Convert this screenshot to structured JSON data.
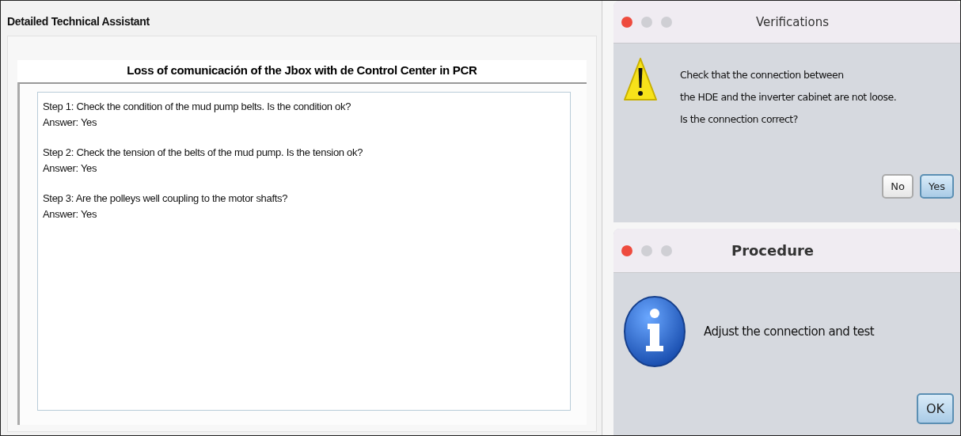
{
  "main_window": {
    "title": "Detailed Technical Assistant",
    "heading": "Loss of comunicación of the Jbox with de Control Center in PCR",
    "steps": [
      {
        "question": "Step 1: Check the condition of the mud pump belts. Is the condition ok?",
        "answer": "Answer: Yes"
      },
      {
        "question": "Step 2: Check the tension of the belts of the mud pump. Is the tension ok?",
        "answer": "Answer: Yes"
      },
      {
        "question": "Step 3: Are the polleys well coupling to the motor shafts?",
        "answer": "Answer: Yes"
      }
    ]
  },
  "dialogs": [
    {
      "title": "Verifications",
      "kind": "warning",
      "lines": [
        "Check that the connection between",
        "the HDE and the inverter cabinet are not loose.",
        "Is the connection correct?"
      ],
      "buttons": [
        {
          "label": "No",
          "selected": false
        },
        {
          "label": "Yes",
          "selected": true
        }
      ]
    },
    {
      "title": "Procedure",
      "kind": "info",
      "lines": [
        "Adjust the connection and test"
      ],
      "buttons": [
        {
          "label": "OK",
          "selected": true
        }
      ]
    }
  ]
}
